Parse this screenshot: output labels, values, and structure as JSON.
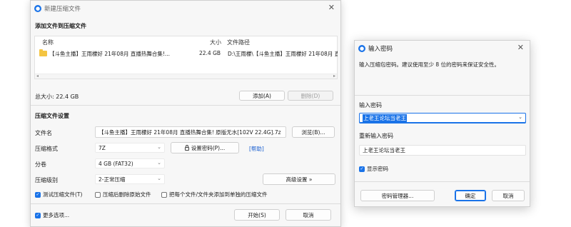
{
  "main_window": {
    "title": "新建压缩文件",
    "close_glyph": "✕",
    "add_files_section": {
      "title": "添加文件到压缩文件",
      "columns": [
        "名称",
        "大小",
        "文件路径"
      ],
      "rows": [
        {
          "name": "【斗鱼主播】王雨檬好 21年08月 直播热舞合集!...",
          "size": "22.4 GB",
          "path": "D:\\王雨檬\\【斗鱼主播】王雨檬好 21年08月 直"
        }
      ],
      "total_size": "总大小: 22.4 GB",
      "add_button": "添加(A)",
      "delete_button": "删除(D)"
    },
    "settings_section": {
      "title": "压缩文件设置",
      "filename_label": "文件名",
      "filename_value": "【斗鱼主播】王雨檬好 21年08月 直播热舞合集! 原版无水[102V 22.4G].7z",
      "browse_button": "浏览(B)...",
      "format_label": "压缩格式",
      "format_value": "7Z",
      "set_password_button": "设置密码(P)...",
      "help_link": "[帮助]",
      "split_label": "分卷",
      "split_value": "4 GB (FAT32)",
      "level_label": "压缩级别",
      "level_value": "2-正常压缩",
      "advanced_button": "高级设置 »",
      "test_checkbox": {
        "label": "测试压缩文件(T)",
        "checked": true
      },
      "delete_source_checkbox": {
        "label": "压缩后删除原始文件",
        "checked": false
      },
      "separate_checkbox": {
        "label": "把每个文件/文件夹添加到单独的压缩文件",
        "checked": false
      }
    },
    "footer": {
      "more_options": {
        "label": "更多选项...",
        "checked": true
      },
      "start_button": "开始(S)",
      "cancel_button": "取消"
    }
  },
  "password_dialog": {
    "title": "输入密码",
    "close_glyph": "✕",
    "hint": "输入压缩包密码。建议使用至少 8 位的密码来保证安全性。",
    "password_label": "输入密码",
    "password_value": "上老王论坛当老王",
    "reenter_label": "重新输入密码",
    "reenter_value": "上老王论坛当老王",
    "show_password": {
      "label": "显示密码",
      "checked": true
    },
    "manager_button": "密码管理器...",
    "ok_button": "确定",
    "cancel_button": "取消"
  },
  "icons": {
    "app": "app-logo-icon",
    "folder": "folder-icon",
    "lock": "lock-icon",
    "chevron": "chevron-down-icon",
    "check": "✓"
  },
  "colors": {
    "accent": "#1a73e8",
    "folder": "#f4c542",
    "link": "#1a5fd0"
  }
}
